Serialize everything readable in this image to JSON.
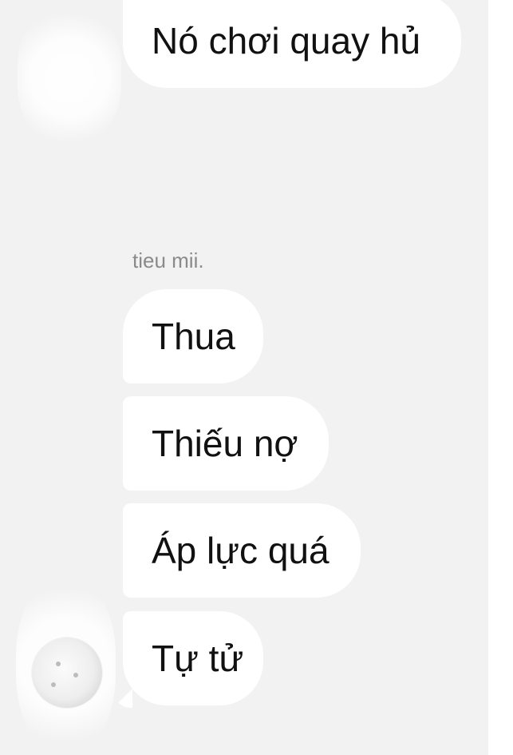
{
  "conversation": {
    "sender_name": "tieu mii.",
    "messages": [
      {
        "text": "Nó chơi quay hủ"
      },
      {
        "text": "Thua"
      },
      {
        "text": "Thiếu nợ"
      },
      {
        "text": "Áp lực quá"
      },
      {
        "text": "Tự tử"
      }
    ]
  },
  "icons": {
    "avatar_top": "avatar-icon",
    "avatar_bottom": "avatar-icon"
  },
  "colors": {
    "chat_background": "#f2f2f2",
    "bubble": "#ffffff",
    "message_text": "#111111",
    "sender_name_text": "#8a8a8a"
  }
}
